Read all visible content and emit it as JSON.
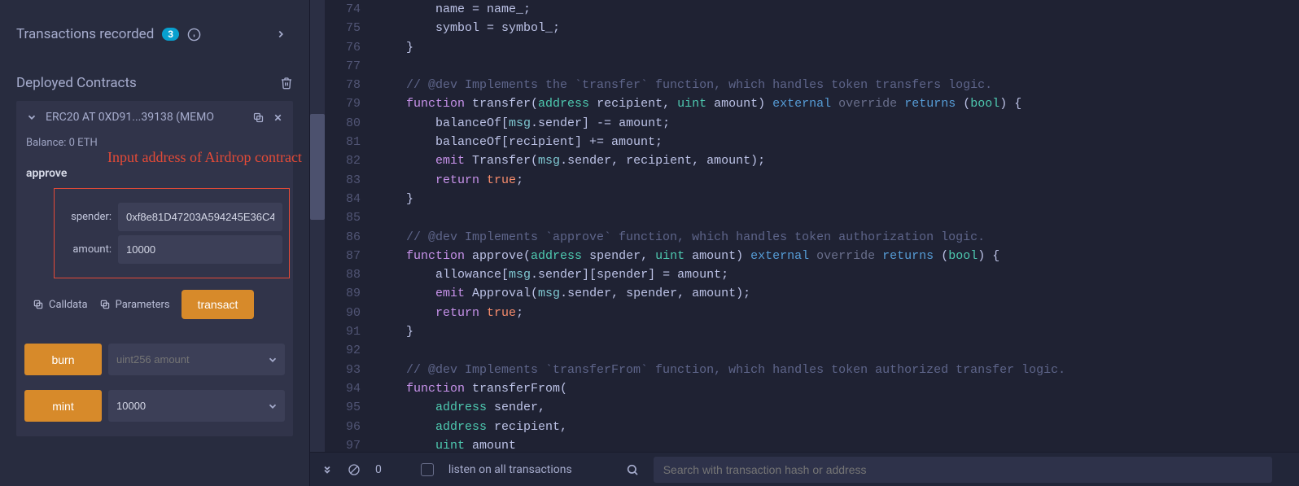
{
  "sidebar": {
    "transactions_label": "Transactions recorded",
    "transactions_count": "3",
    "deployed_label": "Deployed Contracts",
    "contract": {
      "title": "ERC20 AT 0XD91...39138 (MEMO",
      "balance": "Balance: 0 ETH",
      "annotation": "Input address of Airdrop contract",
      "approve": {
        "label": "approve",
        "spender_label": "spender:",
        "spender_value": "0xf8e81D47203A594245E36C4",
        "amount_label": "amount:",
        "amount_value": "10000",
        "calldata": "Calldata",
        "parameters": "Parameters",
        "transact": "transact"
      },
      "burn": {
        "label": "burn",
        "placeholder": "uint256 amount"
      },
      "mint": {
        "label": "mint",
        "value": "10000"
      }
    }
  },
  "bottombar": {
    "count": "0",
    "listen": "listen on all transactions",
    "search_ph": "Search with transaction hash or address"
  },
  "code": {
    "start": 74,
    "lines": [
      "        name = name_;",
      "        symbol = symbol_;",
      "    }",
      "",
      "    // @dev Implements the `transfer` function, which handles token transfers logic.",
      "    function transfer(address recipient, uint amount) external override returns (bool) {",
      "        balanceOf[msg.sender] -= amount;",
      "        balanceOf[recipient] += amount;",
      "        emit Transfer(msg.sender, recipient, amount);",
      "        return true;",
      "    }",
      "",
      "    // @dev Implements `approve` function, which handles token authorization logic.",
      "    function approve(address spender, uint amount) external override returns (bool) {",
      "        allowance[msg.sender][spender] = amount;",
      "        emit Approval(msg.sender, spender, amount);",
      "        return true;",
      "    }",
      "",
      "    // @dev Implements `transferFrom` function, which handles token authorized transfer logic.",
      "    function transferFrom(",
      "        address sender,",
      "        address recipient,",
      "        uint amount"
    ]
  }
}
